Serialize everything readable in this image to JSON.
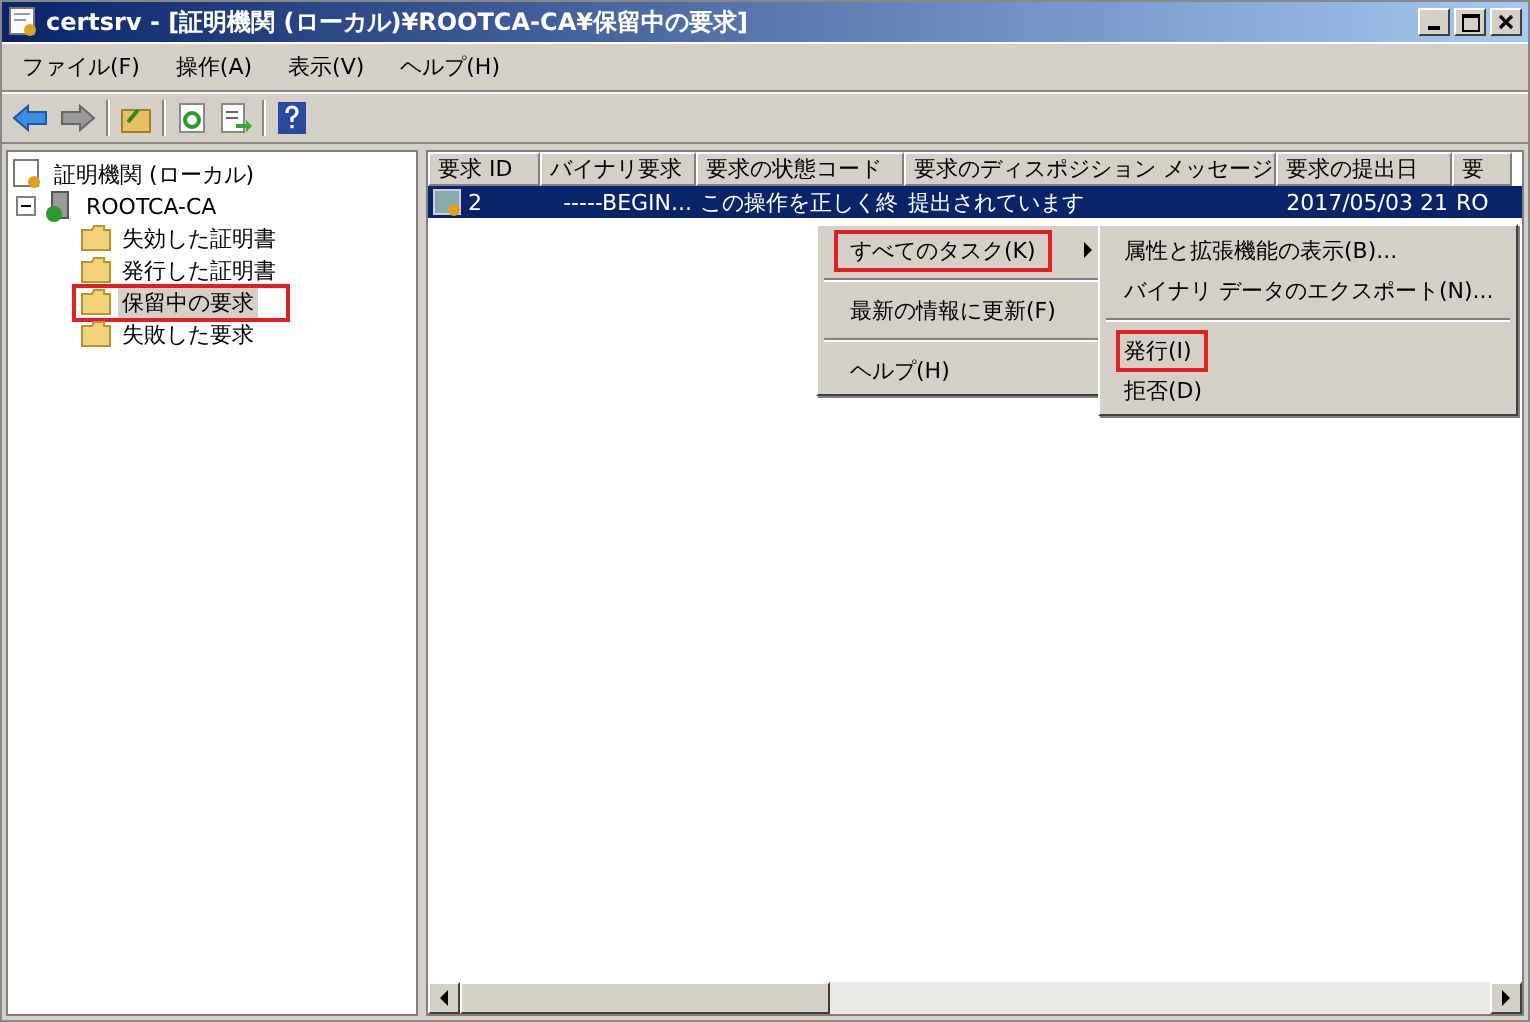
{
  "window": {
    "title": "certsrv - [証明機関 (ローカル)¥ROOTCA-CA¥保留中の要求]"
  },
  "menu_bar": [
    "ファイル(F)",
    "操作(A)",
    "表示(V)",
    "ヘルプ(H)"
  ],
  "tree": {
    "label": "証明機関 (ローカル)",
    "children": [
      {
        "label": "ROOTCA-CA",
        "expanded": true,
        "children": [
          {
            "label": "失効した証明書",
            "selected": false,
            "highlighted": false
          },
          {
            "label": "発行した証明書",
            "selected": false,
            "highlighted": false
          },
          {
            "label": "保留中の要求",
            "selected": true,
            "highlighted": true
          },
          {
            "label": "失敗した要求",
            "selected": false,
            "highlighted": false
          }
        ]
      }
    ]
  },
  "table": {
    "columns": [
      "要求 ID",
      "バイナリ要求",
      "要求の状態コード",
      "要求のディスポジション メッセージ",
      "要求の提出日",
      "要"
    ],
    "rows": [
      {
        "selected": true,
        "cells": [
          "2",
          "-----BEGIN...",
          "この操作を正しく終",
          "提出されています",
          "2017/05/03 21",
          "RO"
        ]
      }
    ]
  },
  "context_menu": {
    "items": [
      {
        "kind": "item",
        "label": "すべてのタスク(K)",
        "submenu": true,
        "highlighted": true
      },
      {
        "kind": "separator"
      },
      {
        "kind": "item",
        "label": "最新の情報に更新(F)",
        "submenu": false,
        "highlighted": false
      },
      {
        "kind": "separator"
      },
      {
        "kind": "item",
        "label": "ヘルプ(H)",
        "submenu": false,
        "highlighted": false
      }
    ]
  },
  "submenu": {
    "items": [
      {
        "kind": "item",
        "label": "属性と拡張機能の表示(B)...",
        "highlighted": false
      },
      {
        "kind": "item",
        "label": "バイナリ データのエクスポート(N)...",
        "highlighted": false
      },
      {
        "kind": "separator"
      },
      {
        "kind": "item",
        "label": "発行(I)",
        "highlighted": true
      },
      {
        "kind": "item",
        "label": "拒否(D)",
        "highlighted": false
      }
    ]
  }
}
